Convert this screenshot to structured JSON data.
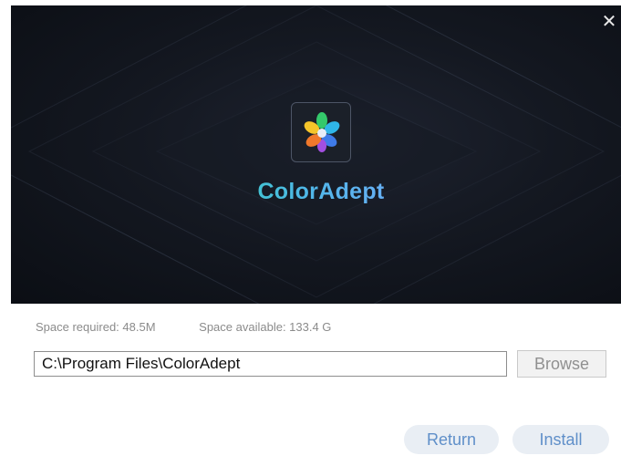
{
  "window": {
    "close_symbol": "✕"
  },
  "hero": {
    "app_name": "ColorAdept",
    "logo_icon": "flower-petals-icon"
  },
  "space": {
    "required": "Space required:  48.5M",
    "available": "Space available:  133.4 G"
  },
  "install_path": {
    "value": "C:\\Program Files\\ColorAdept"
  },
  "buttons": {
    "browse": "Browse",
    "return": "Return",
    "install": "Install"
  },
  "colors": {
    "accent_text": "#5f8fc9",
    "button_bg": "#e9eef4",
    "hero_bg": "#141821"
  }
}
